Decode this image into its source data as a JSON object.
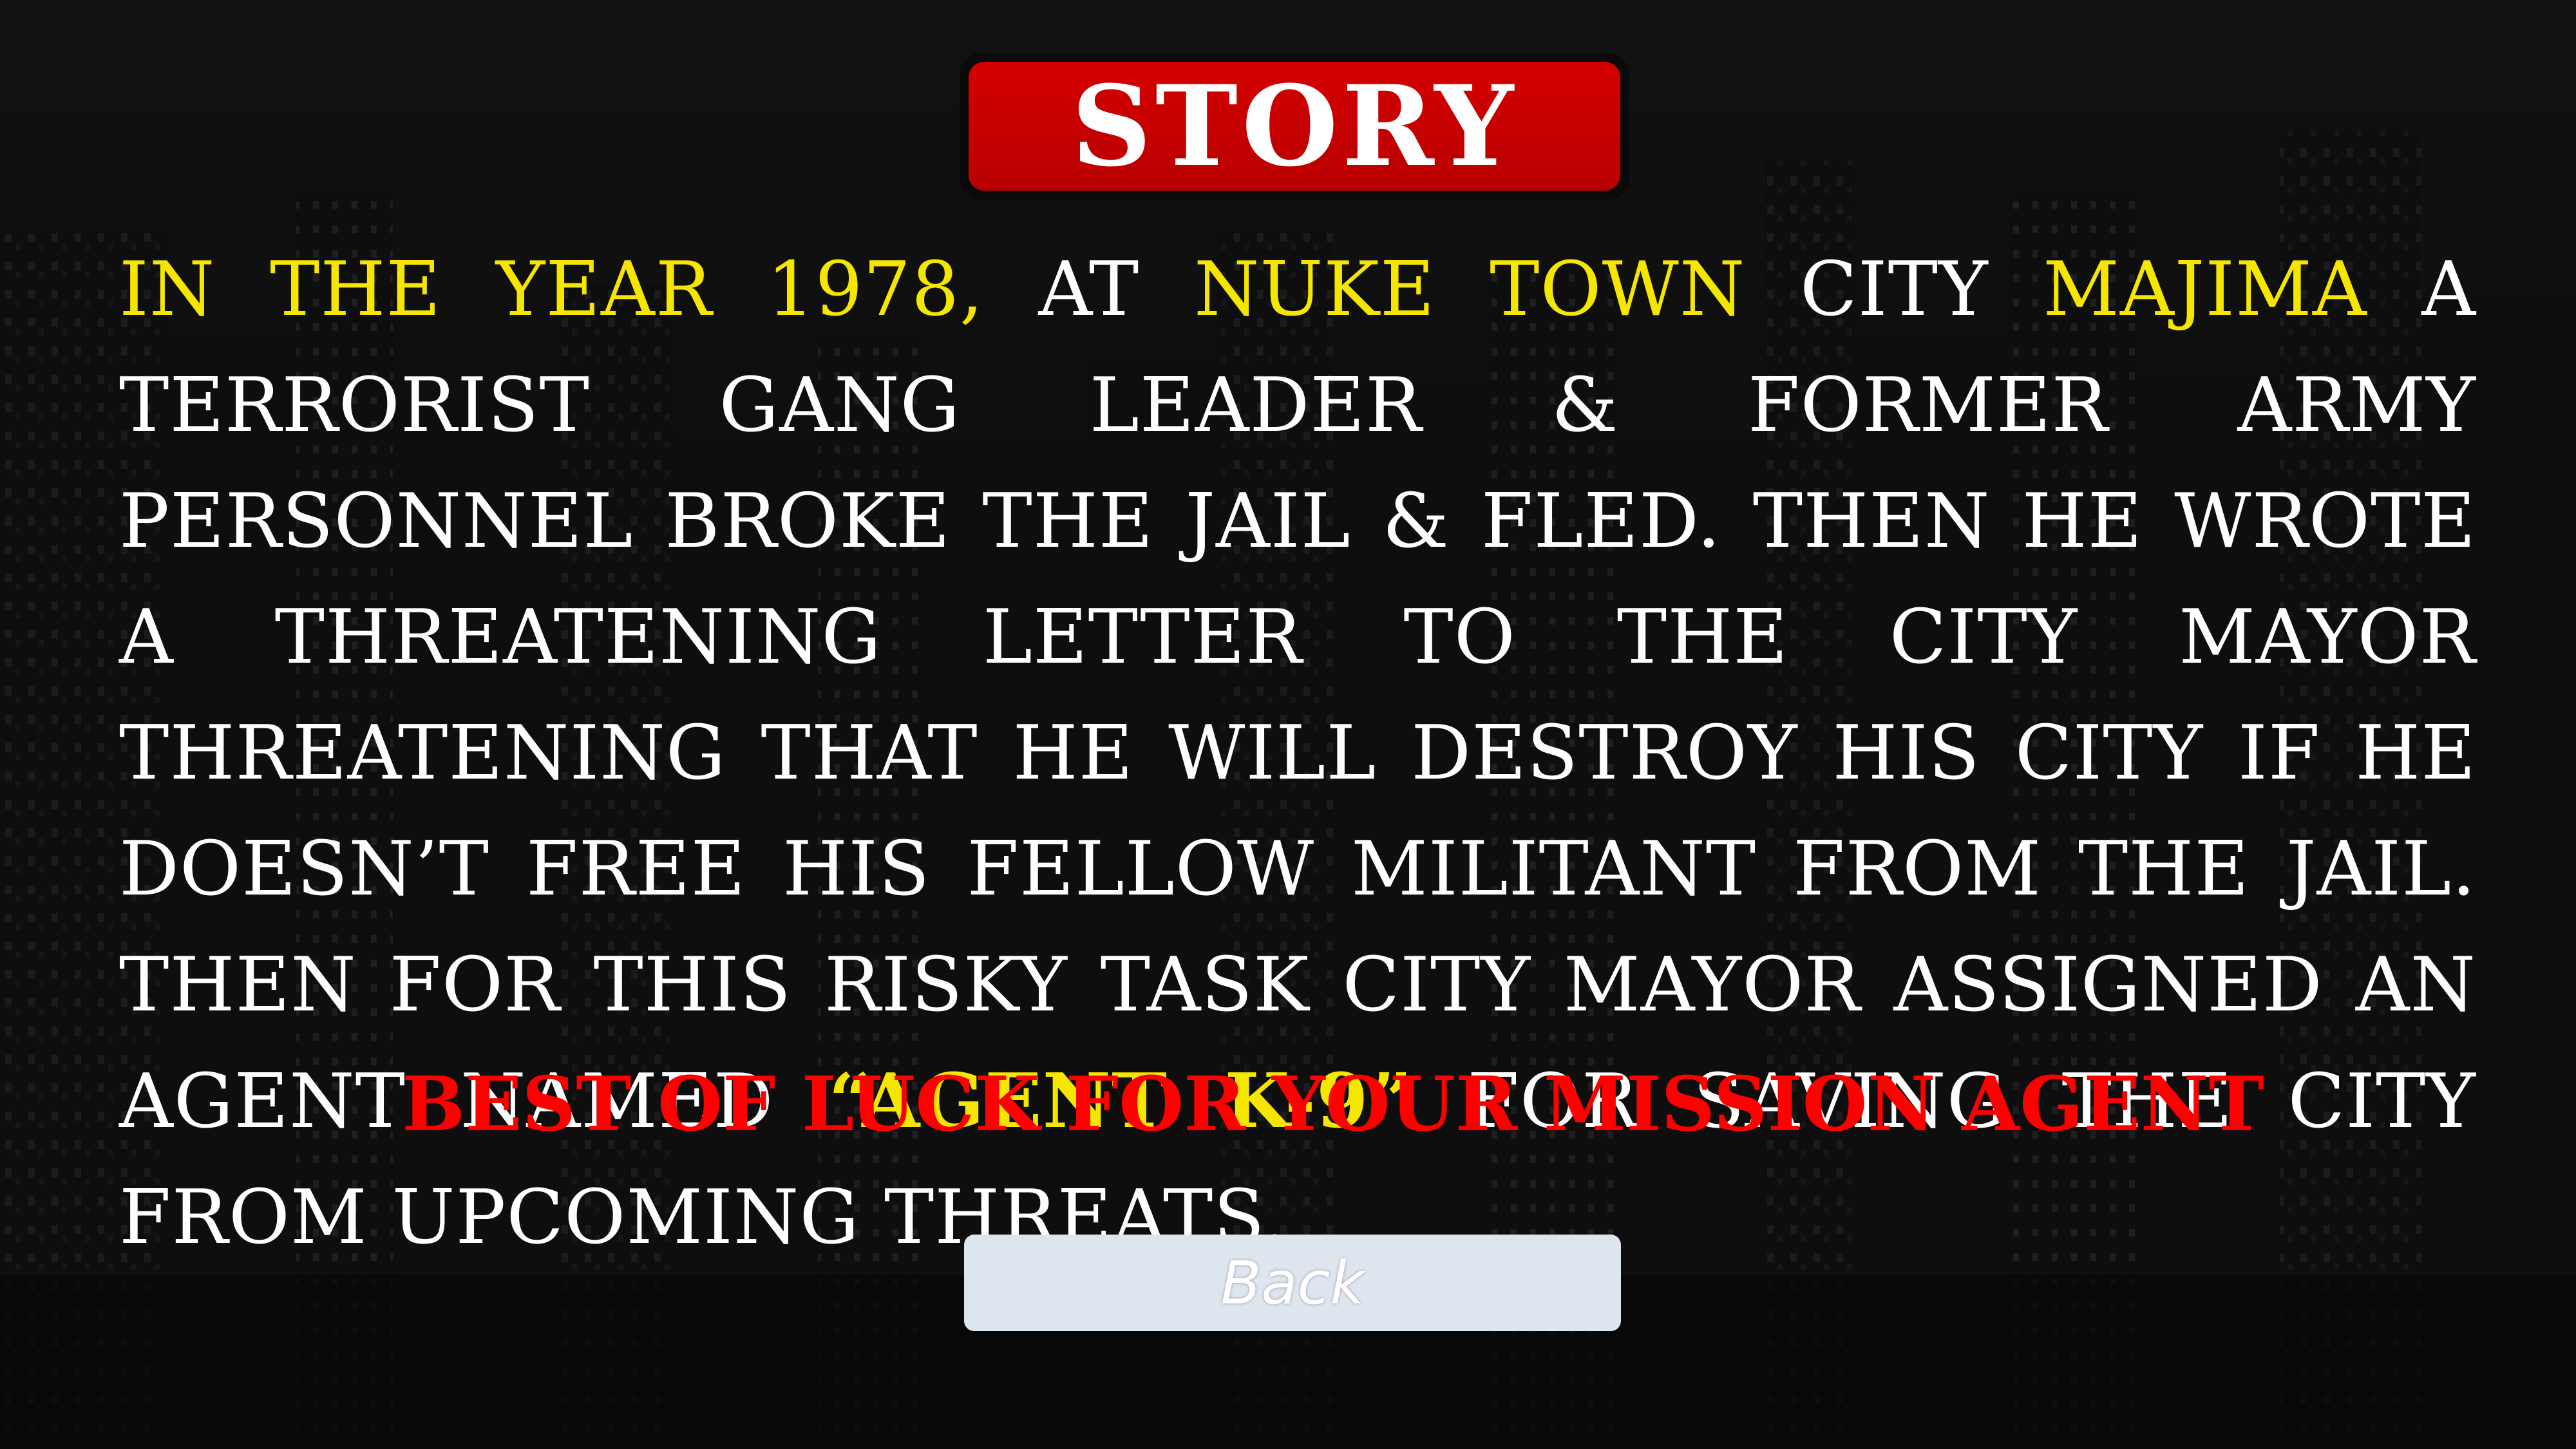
{
  "title": "STORY",
  "story": {
    "seg01": "In the year 1978,",
    "seg02": " at ",
    "seg03": "Nuke Town",
    "seg04": " city ",
    "seg05": "Majima",
    "seg06": " a terrorist gang leader & former army personnel broke the jail & fled. Then he wrote a threatening letter to the city mayor threatening that he will destroy his city if he doesn’t free his fellow militant from the jail. Then for this risky task city mayor assigned an agent named ",
    "seg07": "“Agent K-9”",
    "seg08": " for saving the city from upcoming threats."
  },
  "farewell": "BEST OF LUCK FOR YOUR MISSION AGENT",
  "back_label": "Back",
  "colors": {
    "banner_red": "#d40000",
    "highlight_yellow": "#f5e600",
    "farewell_red": "#ff0000",
    "button_bg": "#dde5ee"
  }
}
